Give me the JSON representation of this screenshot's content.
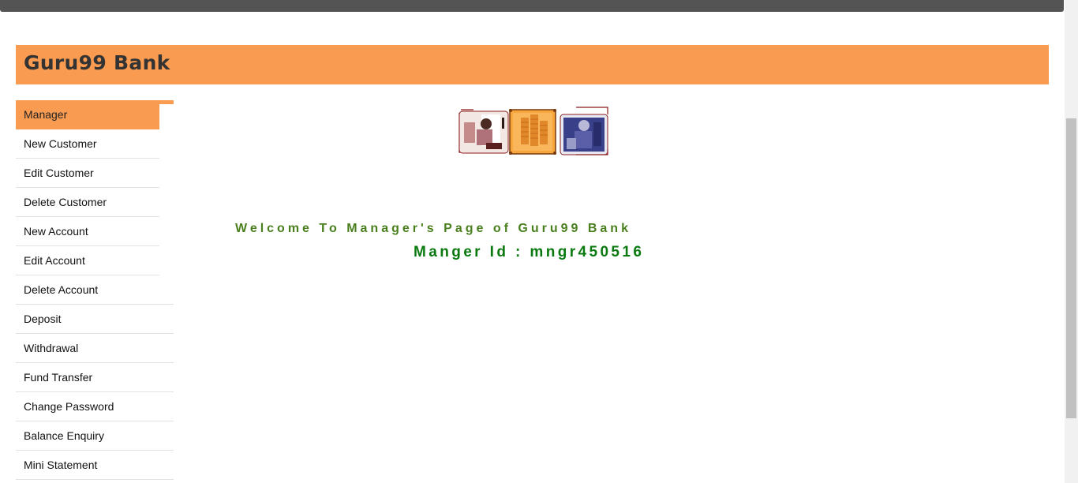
{
  "header": {
    "title": "Guru99 Bank"
  },
  "sidebar": {
    "items": [
      {
        "label": "Manager"
      },
      {
        "label": "New Customer"
      },
      {
        "label": "Edit Customer"
      },
      {
        "label": "Delete Customer"
      },
      {
        "label": "New Account"
      },
      {
        "label": "Edit Account"
      },
      {
        "label": "Delete Account"
      },
      {
        "label": "Deposit"
      },
      {
        "label": "Withdrawal"
      },
      {
        "label": "Fund Transfer"
      },
      {
        "label": "Change Password"
      },
      {
        "label": "Balance Enquiry"
      },
      {
        "label": "Mini Statement"
      }
    ],
    "active_item": "Manager"
  },
  "main": {
    "welcome_text": "Welcome To Manager's Page of Guru99 Bank",
    "manager_id_text": "Manger Id : mngr450516",
    "banner_icon": "bank-banner-image"
  },
  "colors": {
    "accent": "#f99b50",
    "welcome": "#4a7f1e",
    "manager_id": "#0a7a10",
    "topbar": "#545454"
  }
}
